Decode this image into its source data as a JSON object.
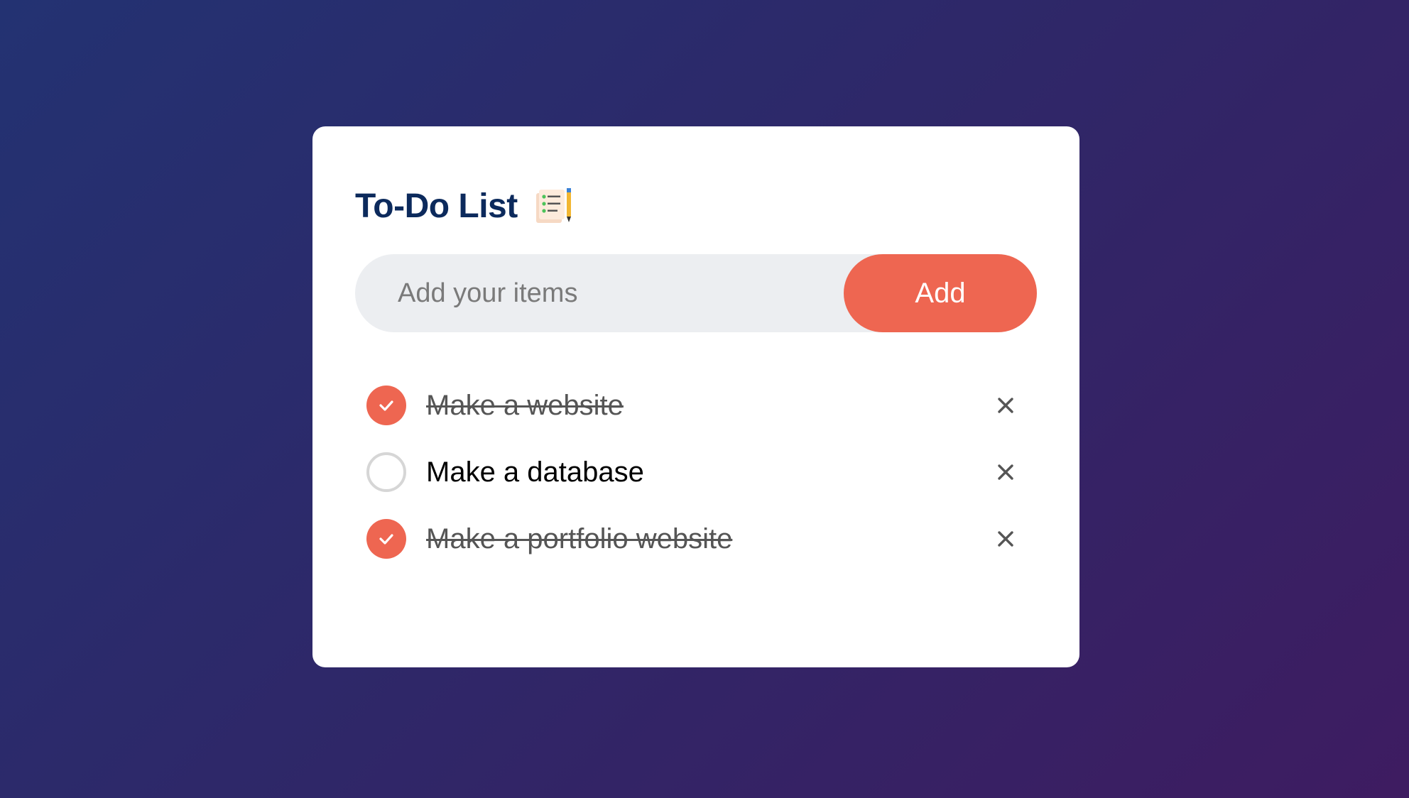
{
  "card": {
    "title": "To-Do List",
    "title_icon": "checklist-pencil-icon"
  },
  "input": {
    "placeholder": "Add your items",
    "value": ""
  },
  "add_button": {
    "label": "Add"
  },
  "todos": [
    {
      "text": "Make a website",
      "done": true
    },
    {
      "text": "Make a database",
      "done": false
    },
    {
      "text": "Make a portfolio website",
      "done": true
    }
  ],
  "colors": {
    "accent": "#ee6651",
    "title": "#0c2a5c",
    "input_bg": "#eceef1",
    "background_start": "#233272",
    "background_end": "#3e1c61"
  },
  "icons": {
    "check": "checkmark-icon",
    "remove": "close-icon"
  }
}
